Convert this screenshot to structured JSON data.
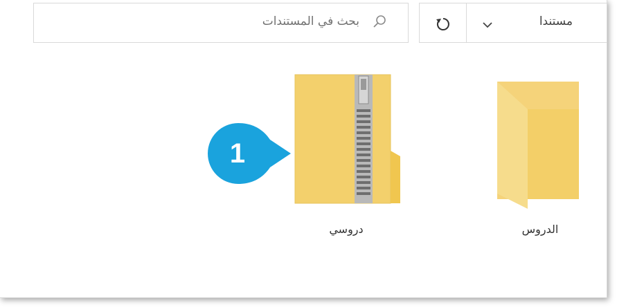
{
  "toolbar": {
    "search_placeholder": "بحث في المستندات",
    "address_text": "مستندا"
  },
  "files": [
    {
      "name": "دروسي",
      "type": "compressed-folder"
    },
    {
      "name": "الدروس",
      "type": "folder"
    }
  ],
  "callout": {
    "number": "1",
    "color": "#1aa3dd"
  },
  "icons": {
    "search": "search-icon",
    "refresh": "refresh-icon",
    "dropdown": "chevron-down-icon"
  }
}
